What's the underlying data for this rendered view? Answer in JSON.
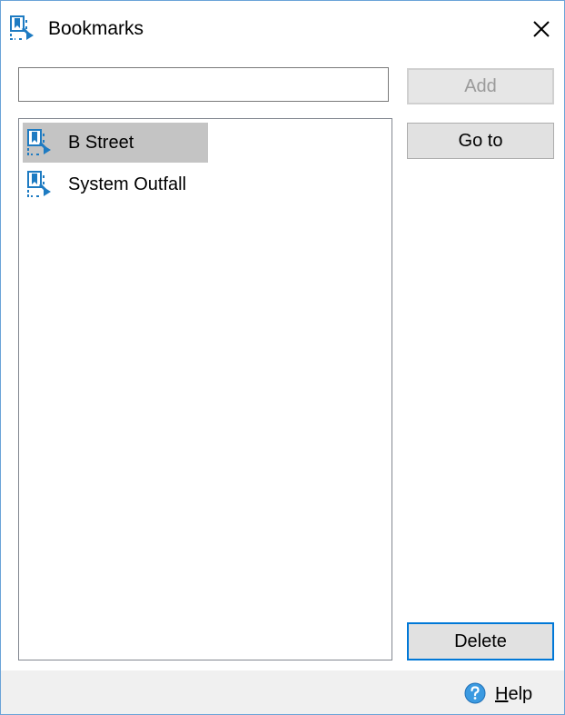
{
  "window": {
    "title": "Bookmarks",
    "title_icon": "bookmark-icon",
    "close_icon": "close-icon"
  },
  "name_input": {
    "value": "",
    "placeholder": ""
  },
  "buttons": {
    "add_label": "Add",
    "goto_label": "Go to",
    "delete_label": "Delete"
  },
  "bookmarks": {
    "items": [
      {
        "label": "B Street",
        "selected": true,
        "icon": "bookmark-icon"
      },
      {
        "label": "System Outfall",
        "selected": false,
        "icon": "bookmark-icon"
      }
    ]
  },
  "footer": {
    "help_mnemonic": "H",
    "help_rest": "elp",
    "help_icon": "help-circle-icon"
  },
  "colors": {
    "window_border": "#6aa3d8",
    "selection": "#c4c4c4",
    "default_button_border": "#0078d7",
    "icon_blue": "#1e7bc2",
    "footer_bg": "#f0f0f0"
  }
}
